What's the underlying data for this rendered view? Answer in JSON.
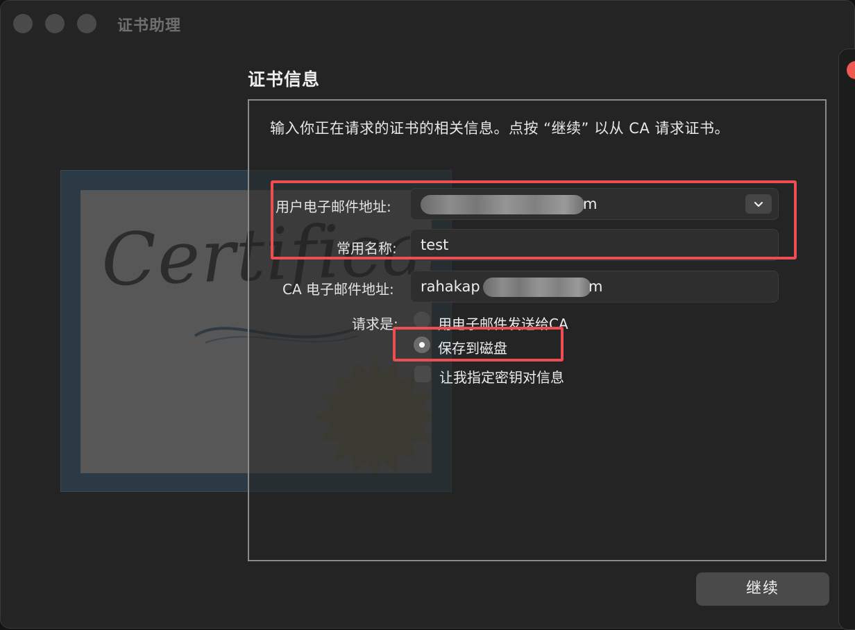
{
  "window": {
    "title": "证书助理"
  },
  "certificate_art": {
    "word": "Certificate"
  },
  "section": {
    "title": "证书信息",
    "intro": "输入你正在请求的证书的相关信息。点按 “继续” 以从 CA 请求证书。"
  },
  "form": {
    "user_email_label": "用户电子邮件地址:",
    "user_email_value_suffix": "m",
    "common_name_label": "常用名称:",
    "common_name_value": "test",
    "ca_email_label": "CA 电子邮件地址:",
    "ca_email_value_prefix": "rahakap",
    "ca_email_value_suffix": "m",
    "request_label": "请求是:",
    "options": [
      {
        "label": "用电子邮件发送给CA",
        "selected": false
      },
      {
        "label": "保存到磁盘",
        "selected": true
      }
    ],
    "checkbox_label": "让我指定密钥对信息",
    "checkbox_checked": false
  },
  "buttons": {
    "continue_label": "继续"
  },
  "colors": {
    "highlight": "#ee4d52",
    "background": "#242424",
    "traffic_light_red": "#ee5a52"
  },
  "icons": {
    "dropdown": "chevron-down-icon"
  }
}
